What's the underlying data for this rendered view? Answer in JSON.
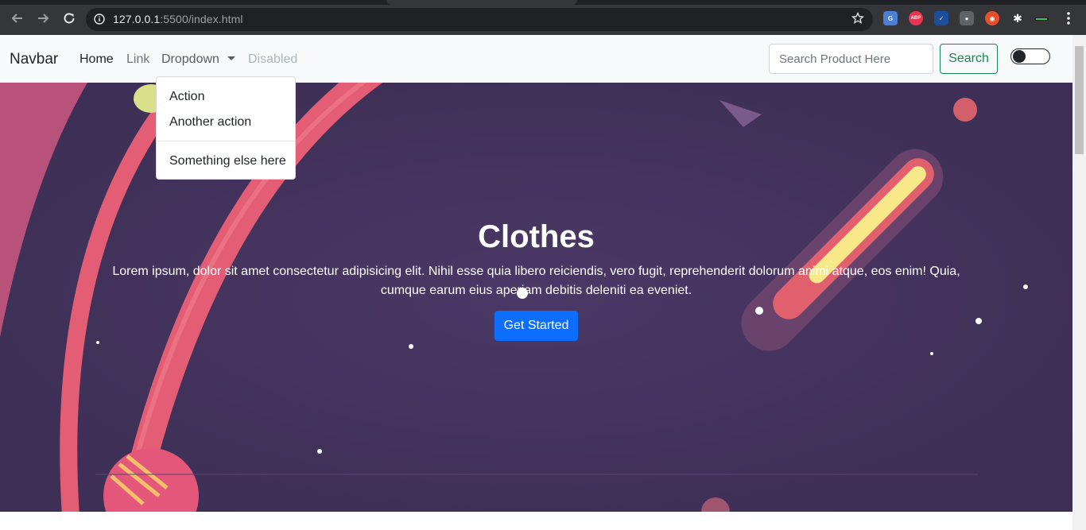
{
  "browser": {
    "url_host": "127.0.0.1",
    "url_rest": ":5500/index.html",
    "extensions": [
      {
        "name": "translate-extension-icon",
        "color": "#4a7fd4",
        "text": "G"
      },
      {
        "name": "adblock-extension-icon",
        "color": "#e8344e",
        "text": "ABP"
      },
      {
        "name": "check-extension-icon",
        "color": "#1b4f9c",
        "text": "✓"
      },
      {
        "name": "spy-extension-icon",
        "color": "#5f6368",
        "text": "●"
      },
      {
        "name": "vpn-extension-icon",
        "color": "#e8502c",
        "text": "◉"
      },
      {
        "name": "puzzle-extension-icon",
        "color": "#35363a",
        "text": "✱"
      }
    ]
  },
  "navbar": {
    "brand": "Navbar",
    "links": [
      {
        "label": "Home",
        "state": "active"
      },
      {
        "label": "Link",
        "state": "normal"
      },
      {
        "label": "Dropdown",
        "state": "normal"
      },
      {
        "label": "Disabled",
        "state": "disabled"
      }
    ],
    "search_placeholder": "Search Product Here",
    "search_button": "Search"
  },
  "dropdown": {
    "items": [
      "Action",
      "Another action",
      "Something else here"
    ]
  },
  "hero": {
    "title": "Clothes",
    "text": "Lorem ipsum, dolor sit amet consectetur adipisicing elit. Nihil esse quia libero reiciendis, vero fugit, reprehenderit dolorum animi atque, eos enim! Quia, cumque earum eius aperiam debitis deleniti ea eveniet.",
    "button": "Get Started"
  },
  "colors": {
    "primary": "#0d6efd",
    "success": "#198754",
    "hero_bg": "#41325a",
    "ring": "#e0506a"
  }
}
